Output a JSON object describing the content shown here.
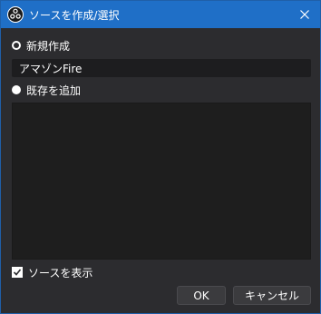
{
  "window": {
    "title": "ソースを作成/選択",
    "app_icon": "obs-logo-icon",
    "close_icon": "close-icon"
  },
  "options": {
    "create_new_label": "新規作成",
    "create_new_selected": true,
    "add_existing_label": "既存を追加",
    "add_existing_selected": false
  },
  "name_field": {
    "value": "アマゾンFire"
  },
  "existing_sources": [],
  "visibility": {
    "label": "ソースを表示",
    "checked": true
  },
  "buttons": {
    "ok_label": "OK",
    "cancel_label": "キャンセル"
  },
  "colors": {
    "titlebar": "#1f6fc7",
    "background": "#2c2c2f",
    "input_bg": "#1d1d1f",
    "list_bg": "#1e1e1e",
    "button_bg": "#3b3b3e"
  }
}
